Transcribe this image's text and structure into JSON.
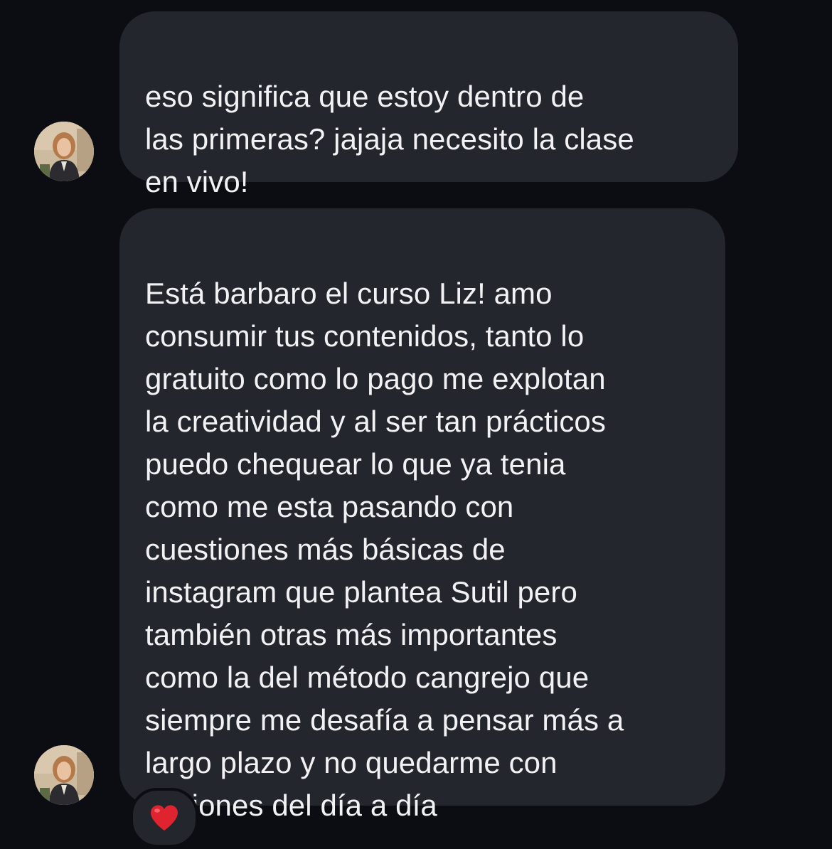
{
  "messages": [
    {
      "text": "eso significa que estoy dentro de\nlas primeras? jajaja necesito la clase\nen vivo!"
    },
    {
      "text": "Está barbaro el curso Liz! amo\nconsumir tus contenidos, tanto lo\ngratuito como lo pago me explotan\nla creatividad y al ser tan prácticos\npuedo chequear lo que ya tenia\ncomo me esta pasando con\ncuestiones más básicas de\ninstagram que plantea Sutil pero\ntambién otras más importantes\ncomo la del método cangrejo que\nsiempre me desafía a pensar más a\nlargo plazo y no quedarme con\nacciones del día a día",
      "reaction": "heart-icon"
    }
  ],
  "colors": {
    "background": "#0c0d12",
    "bubble": "#24262e",
    "text": "#f2f2f4",
    "reaction_heart": "#e0242f"
  }
}
